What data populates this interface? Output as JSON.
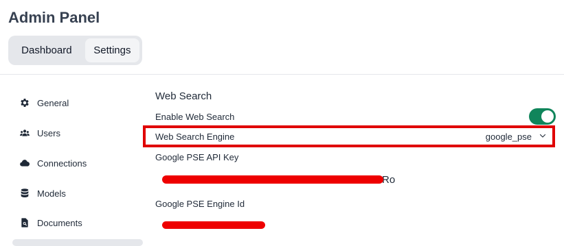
{
  "header": {
    "title": "Admin Panel"
  },
  "tabs": [
    {
      "label": "Dashboard"
    },
    {
      "label": "Settings"
    }
  ],
  "sidebar": {
    "items": [
      {
        "label": "General",
        "icon": "gear-icon"
      },
      {
        "label": "Users",
        "icon": "users-icon"
      },
      {
        "label": "Connections",
        "icon": "cloud-icon"
      },
      {
        "label": "Models",
        "icon": "database-icon"
      },
      {
        "label": "Documents",
        "icon": "document-search-icon"
      }
    ]
  },
  "web_search": {
    "title": "Web Search",
    "enable_label": "Enable Web Search",
    "enabled": true,
    "engine_label": "Web Search Engine",
    "engine_value": "google_pse",
    "api_key_label": "Google PSE API Key",
    "api_key_visible_tail": "Ro",
    "engine_id_label": "Google PSE Engine Id"
  },
  "colors": {
    "toggle_on": "#10855b",
    "highlight": "#e00000",
    "redaction": "#ee0000"
  }
}
